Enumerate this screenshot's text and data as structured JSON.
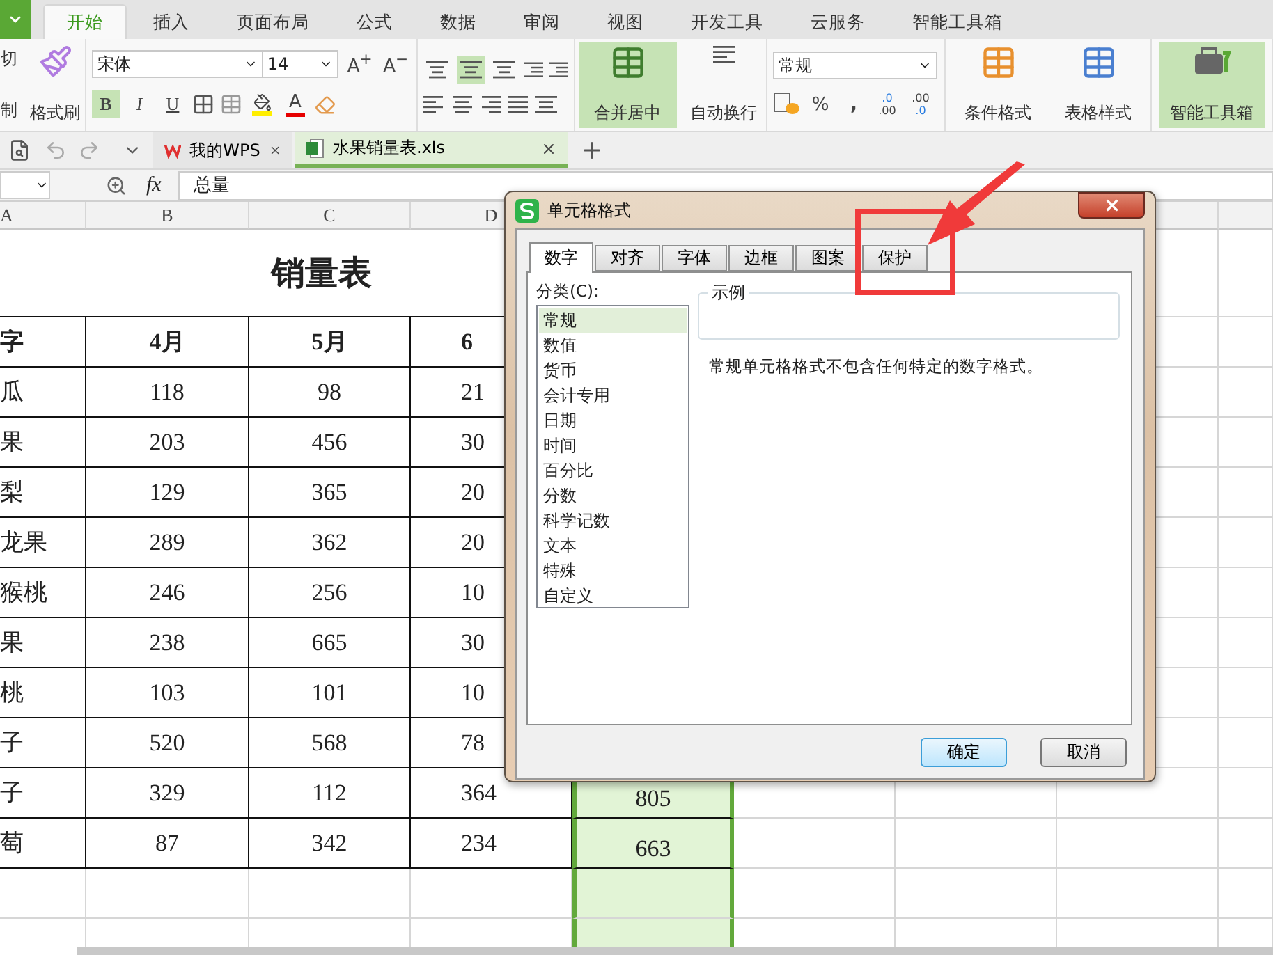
{
  "ribbon_tabs": [
    {
      "label": "开始",
      "selected": true
    },
    {
      "label": "插入",
      "selected": false
    },
    {
      "label": "页面布局",
      "selected": false
    },
    {
      "label": "公式",
      "selected": false
    },
    {
      "label": "数据",
      "selected": false
    },
    {
      "label": "审阅",
      "selected": false
    },
    {
      "label": "视图",
      "selected": false
    },
    {
      "label": "开发工具",
      "selected": false
    },
    {
      "label": "云服务",
      "selected": false
    },
    {
      "label": "智能工具箱",
      "selected": false
    }
  ],
  "ribbon": {
    "clipboard": {
      "cut": "切",
      "copy": "制",
      "format_painter": "格式刷"
    },
    "font": {
      "family": "宋体",
      "size": "14",
      "grow": "A$^{+}$",
      "shrink": "A$^{−}$",
      "styles": [
        {
          "label": "B",
          "selected": true
        },
        {
          "label": "I",
          "selected": false
        },
        {
          "label": "U",
          "selected": false
        }
      ],
      "font_color": "A"
    },
    "vertical_align": [
      {
        "selected": false
      },
      {
        "selected": true
      },
      {
        "selected": false
      }
    ],
    "merge_center": "合并居中",
    "wrap_text": "自动换行",
    "number": {
      "format": "常规",
      "percent": "%",
      "comma": ",",
      "increase_decimal": [
        ".0",
        ".00"
      ],
      "decrease_decimal": [
        ".00",
        ".0"
      ]
    },
    "conditional_format": "条件格式",
    "table_style": "表格样式",
    "smart_toolbox": "智能工具箱"
  },
  "doc_tabs": [
    {
      "label": "我的WPS",
      "selected": false,
      "kind": "home"
    },
    {
      "label": "水果销量表.xls",
      "selected": true,
      "kind": "sheet"
    }
  ],
  "formula_bar": {
    "fx": "fx",
    "value": "总量"
  },
  "sheet": {
    "column_headers": [
      "A",
      "B",
      "C",
      "D"
    ],
    "title": "销量表",
    "header": [
      "字",
      "4月",
      "5月",
      "6"
    ],
    "column_e": {
      "selected": true
    },
    "rows": [
      {
        "cells": [
          "瓜",
          "118",
          "98",
          "21"
        ]
      },
      {
        "cells": [
          "果",
          "203",
          "456",
          "30"
        ]
      },
      {
        "cells": [
          "梨",
          "129",
          "365",
          "20"
        ]
      },
      {
        "cells": [
          "龙果",
          "289",
          "362",
          "20"
        ]
      },
      {
        "cells": [
          "猴桃",
          "246",
          "256",
          "10"
        ]
      },
      {
        "cells": [
          "果",
          "238",
          "665",
          "30"
        ]
      },
      {
        "cells": [
          "桃",
          "103",
          "101",
          "10"
        ]
      },
      {
        "cells": [
          "子",
          "520",
          "568",
          "78"
        ]
      },
      {
        "cells": [
          "子",
          "329",
          "112",
          "364",
          "805"
        ]
      },
      {
        "cells": [
          "萄",
          "87",
          "342",
          "234",
          "663"
        ]
      }
    ]
  },
  "dialog": {
    "title": "单元格格式",
    "tabs": [
      {
        "label": "数字",
        "selected": true
      },
      {
        "label": "对齐",
        "selected": false
      },
      {
        "label": "字体",
        "selected": false
      },
      {
        "label": "边框",
        "selected": false
      },
      {
        "label": "图案",
        "selected": false
      },
      {
        "label": "保护",
        "selected": false
      }
    ],
    "category_label": "分类(C):",
    "categories": [
      {
        "label": "常规",
        "selected": true
      },
      {
        "label": "数值",
        "selected": false
      },
      {
        "label": "货币",
        "selected": false
      },
      {
        "label": "会计专用",
        "selected": false
      },
      {
        "label": "日期",
        "selected": false
      },
      {
        "label": "时间",
        "selected": false
      },
      {
        "label": "百分比",
        "selected": false
      },
      {
        "label": "分数",
        "selected": false
      },
      {
        "label": "科学记数",
        "selected": false
      },
      {
        "label": "文本",
        "selected": false
      },
      {
        "label": "特殊",
        "selected": false
      },
      {
        "label": "自定义",
        "selected": false
      }
    ],
    "sample_label": "示例",
    "description": "常规单元格格式不包含任何特定的数字格式。",
    "buttons": [
      {
        "label": "确定",
        "kind": "default"
      },
      {
        "label": "取消",
        "kind": "normal"
      }
    ]
  }
}
